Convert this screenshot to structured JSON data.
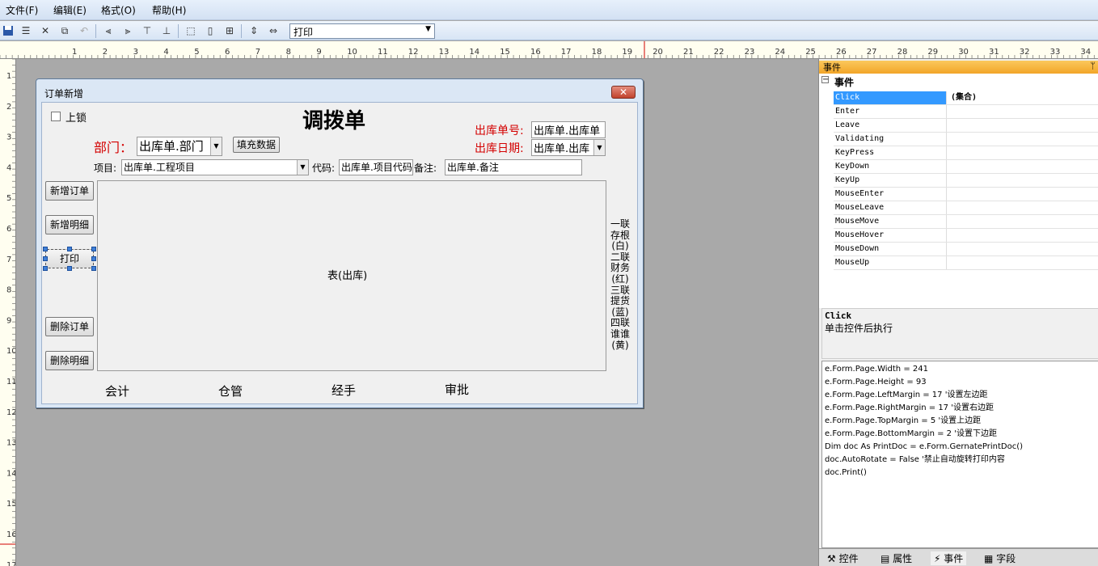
{
  "menu": [
    "文件(F)",
    "编辑(E)",
    "格式(O)",
    "帮助(H)"
  ],
  "toolbar": {
    "combo_value": "打印"
  },
  "ruler": {
    "h_numbers": [
      "1",
      "2",
      "3",
      "4",
      "5",
      "6",
      "7",
      "8",
      "9",
      "10",
      "11",
      "12",
      "13",
      "14",
      "15",
      "16",
      "17",
      "18",
      "19",
      "20",
      "21",
      "22",
      "23",
      "24",
      "25",
      "26",
      "27",
      "28",
      "29",
      "30",
      "31",
      "32",
      "33",
      "34"
    ],
    "v_numbers": [
      "1",
      "2",
      "3",
      "4",
      "5",
      "6",
      "7",
      "8",
      "9",
      "10",
      "11",
      "12",
      "13",
      "14",
      "15",
      "16",
      "17"
    ]
  },
  "form": {
    "title": "订单新增",
    "lock_label": "上锁",
    "heading": "调拨单",
    "dept_label": "部门：",
    "dept_value": "出库单.部门",
    "fill_button": "填充数据",
    "out_no_label": "出库单号:",
    "out_no_value": "出库单.出库单",
    "out_date_label": "出库日期:",
    "out_date_value": "出库单.出库",
    "project_label": "项目:",
    "project_value": "出库单.工程项目",
    "code_label": "代码:",
    "code_value": "出库单.项目代码",
    "remark_label": "备注:",
    "remark_value": "出库单.备注",
    "buttons": [
      "新增订单",
      "新增明细",
      "打印",
      "删除订单",
      "删除明细"
    ],
    "table_label": "表(出库)",
    "copies_text": [
      "一联",
      "存根",
      "(白)",
      "二联",
      "财务",
      "(红)",
      "三联",
      "提货",
      "(蓝)",
      "四联",
      "谁谁",
      "(黄)"
    ],
    "signatures": [
      "会计",
      "仓管",
      "经手",
      "审批"
    ]
  },
  "panel": {
    "title": "事件",
    "group": "事件",
    "events": [
      {
        "name": "Click",
        "value": "(集合)"
      },
      {
        "name": "Enter",
        "value": ""
      },
      {
        "name": "Leave",
        "value": ""
      },
      {
        "name": "Validating",
        "value": ""
      },
      {
        "name": "KeyPress",
        "value": ""
      },
      {
        "name": "KeyDown",
        "value": ""
      },
      {
        "name": "KeyUp",
        "value": ""
      },
      {
        "name": "MouseEnter",
        "value": ""
      },
      {
        "name": "MouseLeave",
        "value": ""
      },
      {
        "name": "MouseMove",
        "value": ""
      },
      {
        "name": "MouseHover",
        "value": ""
      },
      {
        "name": "MouseDown",
        "value": ""
      },
      {
        "name": "MouseUp",
        "value": ""
      }
    ],
    "desc_title": "Click",
    "desc_text": "单击控件后执行",
    "code_lines": [
      "e.Form.Page.Width = 241",
      "e.Form.Page.Height = 93",
      "e.Form.Page.LeftMargin = 17 '设置左边距",
      "e.Form.Page.RightMargin = 17 '设置右边距",
      "e.Form.Page.TopMargin = 5 '设置上边距",
      "e.Form.Page.BottomMargin = 2 '设置下边距",
      "Dim doc As PrintDoc = e.Form.GernatePrintDoc()",
      "doc.AutoRotate = False '禁止自动旋转打印内容",
      "doc.Print()"
    ],
    "tabs": [
      "控件",
      "属性",
      "事件",
      "字段"
    ]
  }
}
